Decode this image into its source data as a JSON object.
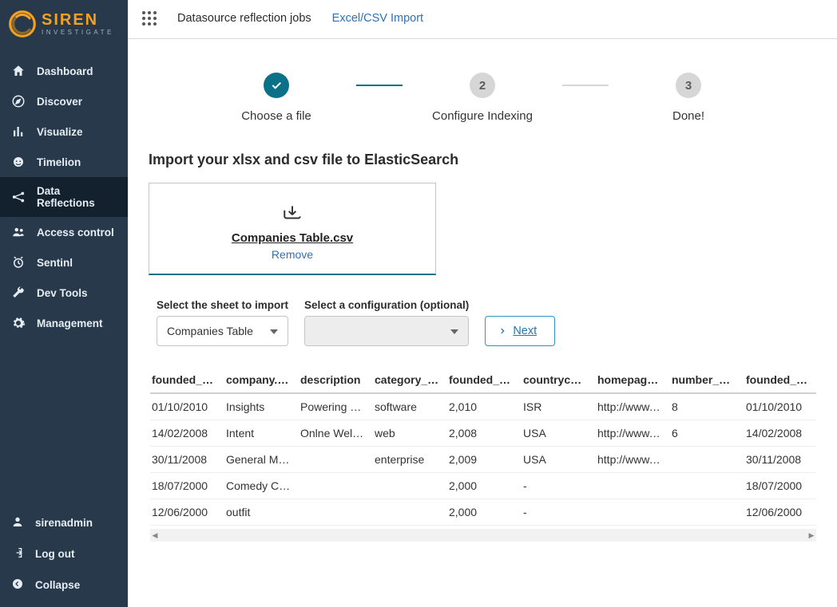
{
  "brand": {
    "main": "SIREN",
    "sub": "INVESTIGATE"
  },
  "sidebar": {
    "items": [
      {
        "label": "Dashboard"
      },
      {
        "label": "Discover"
      },
      {
        "label": "Visualize"
      },
      {
        "label": "Timelion"
      },
      {
        "label": "Data Reflections"
      },
      {
        "label": "Access control"
      },
      {
        "label": "Sentinl"
      },
      {
        "label": "Dev Tools"
      },
      {
        "label": "Management"
      }
    ],
    "bottom": [
      {
        "label": "sirenadmin"
      },
      {
        "label": "Log out"
      },
      {
        "label": "Collapse"
      }
    ]
  },
  "topbar": {
    "tabs": [
      {
        "label": "Datasource reflection jobs"
      },
      {
        "label": "Excel/CSV Import"
      }
    ]
  },
  "stepper": {
    "steps": [
      {
        "label": "Choose a file",
        "mark": "✓"
      },
      {
        "label": "Configure Indexing",
        "mark": "2"
      },
      {
        "label": "Done!",
        "mark": "3"
      }
    ]
  },
  "page": {
    "title": "Import your xlsx and csv file to ElasticSearch",
    "filename": "Companies Table.csv",
    "remove_label": "Remove",
    "sheet_label": "Select the sheet to import",
    "sheet_value": "Companies Table",
    "config_label": "Select a configuration (optional)",
    "config_value": "",
    "next_label": "Next"
  },
  "table": {
    "columns": [
      "founded_date",
      "company.na…",
      "description",
      "category_code",
      "founded_year",
      "countrycode",
      "homepage_url",
      "number_of_e…",
      "founded_date"
    ],
    "rows": [
      [
        "01/10/2010",
        "Insights",
        "Powering L…",
        "software",
        "2,010",
        "ISR",
        "http://www.…",
        "8",
        "01/10/2010"
      ],
      [
        "14/02/2008",
        "Intent",
        "Onlne Well…",
        "web",
        "2,008",
        "USA",
        "http://www.…",
        "6",
        "14/02/2008"
      ],
      [
        "30/11/2008",
        "General Mo…",
        "",
        "enterprise",
        "2,009",
        "USA",
        "http://www.…",
        "",
        "30/11/2008"
      ],
      [
        "18/07/2000",
        "Comedy Ce…",
        "",
        "",
        "2,000",
        "-",
        "",
        "",
        "18/07/2000"
      ],
      [
        "12/06/2000",
        "outfit",
        "",
        "",
        "2,000",
        "-",
        "",
        "",
        "12/06/2000"
      ]
    ]
  }
}
